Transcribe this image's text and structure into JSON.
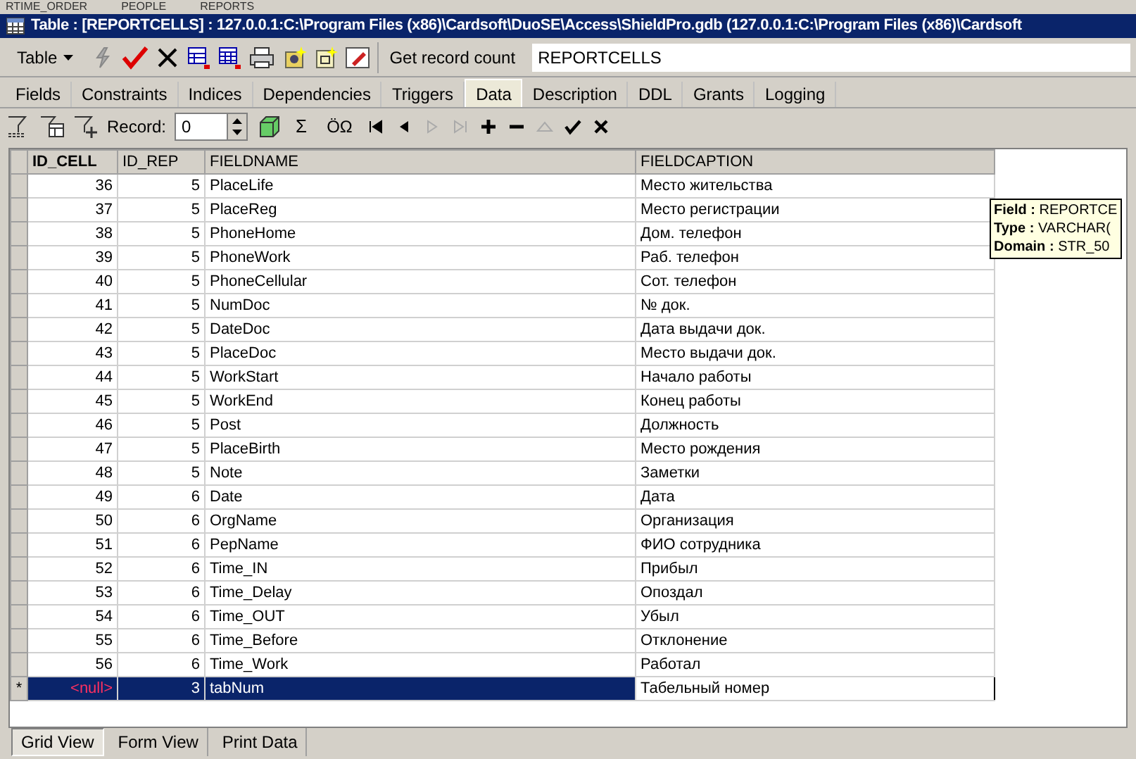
{
  "background_tabs": [
    "RTIME_ORDER",
    "PEOPLE",
    "REPORTS"
  ],
  "window": {
    "title": "Table : [REPORTCELLS] : 127.0.0.1:C:\\Program Files (x86)\\Cardsoft\\DuoSE\\Access\\ShieldPro.gdb (127.0.0.1:C:\\Program Files (x86)\\Cardsoft"
  },
  "toolbar": {
    "table_menu": "Table",
    "record_count_button": "Get record count",
    "table_name": "REPORTCELLS"
  },
  "tabs": [
    {
      "label": "Fields",
      "selected": false
    },
    {
      "label": "Constraints",
      "selected": false
    },
    {
      "label": "Indices",
      "selected": false
    },
    {
      "label": "Dependencies",
      "selected": false
    },
    {
      "label": "Triggers",
      "selected": false
    },
    {
      "label": "Data",
      "selected": true
    },
    {
      "label": "Description",
      "selected": false
    },
    {
      "label": "DDL",
      "selected": false
    },
    {
      "label": "Grants",
      "selected": false
    },
    {
      "label": "Logging",
      "selected": false
    }
  ],
  "data_toolbar": {
    "record_label": "Record:",
    "record_value": "0",
    "sum_symbol": "Σ",
    "special_chars": "ÖΩ"
  },
  "table": {
    "columns": [
      "ID_CELL",
      "ID_REP",
      "FIELDNAME",
      "FIELDCAPTION"
    ],
    "rows": [
      {
        "cells": [
          "36",
          "5",
          "PlaceLife",
          "Место жительства"
        ],
        "selected": false,
        "marker": ""
      },
      {
        "cells": [
          "37",
          "5",
          "PlaceReg",
          "Место регистрации"
        ],
        "selected": false,
        "marker": ""
      },
      {
        "cells": [
          "38",
          "5",
          "PhoneHome",
          "Дом. телефон"
        ],
        "selected": false,
        "marker": ""
      },
      {
        "cells": [
          "39",
          "5",
          "PhoneWork",
          "Раб. телефон"
        ],
        "selected": false,
        "marker": ""
      },
      {
        "cells": [
          "40",
          "5",
          "PhoneCellular",
          "Сот. телефон"
        ],
        "selected": false,
        "marker": ""
      },
      {
        "cells": [
          "41",
          "5",
          "NumDoc",
          "№ док."
        ],
        "selected": false,
        "marker": ""
      },
      {
        "cells": [
          "42",
          "5",
          "DateDoc",
          "Дата выдачи док."
        ],
        "selected": false,
        "marker": ""
      },
      {
        "cells": [
          "43",
          "5",
          "PlaceDoc",
          "Место выдачи док."
        ],
        "selected": false,
        "marker": ""
      },
      {
        "cells": [
          "44",
          "5",
          "WorkStart",
          "Начало работы"
        ],
        "selected": false,
        "marker": ""
      },
      {
        "cells": [
          "45",
          "5",
          "WorkEnd",
          "Конец работы"
        ],
        "selected": false,
        "marker": ""
      },
      {
        "cells": [
          "46",
          "5",
          "Post",
          "Должность"
        ],
        "selected": false,
        "marker": ""
      },
      {
        "cells": [
          "47",
          "5",
          "PlaceBirth",
          "Место рождения"
        ],
        "selected": false,
        "marker": ""
      },
      {
        "cells": [
          "48",
          "5",
          "Note",
          "Заметки"
        ],
        "selected": false,
        "marker": ""
      },
      {
        "cells": [
          "49",
          "6",
          "Date",
          "Дата"
        ],
        "selected": false,
        "marker": ""
      },
      {
        "cells": [
          "50",
          "6",
          "OrgName",
          "Организация"
        ],
        "selected": false,
        "marker": ""
      },
      {
        "cells": [
          "51",
          "6",
          "PepName",
          "ФИО сотрудника"
        ],
        "selected": false,
        "marker": ""
      },
      {
        "cells": [
          "52",
          "6",
          "Time_IN",
          "Прибыл"
        ],
        "selected": false,
        "marker": ""
      },
      {
        "cells": [
          "53",
          "6",
          "Time_Delay",
          "Опоздал"
        ],
        "selected": false,
        "marker": ""
      },
      {
        "cells": [
          "54",
          "6",
          "Time_OUT",
          "Убыл"
        ],
        "selected": false,
        "marker": ""
      },
      {
        "cells": [
          "55",
          "6",
          "Time_Before",
          "Отклонение"
        ],
        "selected": false,
        "marker": ""
      },
      {
        "cells": [
          "56",
          "6",
          "Time_Work",
          "Работал"
        ],
        "selected": false,
        "marker": ""
      },
      {
        "cells": [
          "<null>",
          "3",
          "tabNum",
          "Табельный номер"
        ],
        "selected": true,
        "marker": "*"
      }
    ]
  },
  "tooltip": {
    "lines": [
      {
        "label": "Field :",
        "value": "REPORTCE"
      },
      {
        "label": "Type :",
        "value": "VARCHAR("
      },
      {
        "label": "Domain :",
        "value": "STR_50"
      }
    ]
  },
  "view_tabs": [
    {
      "label": "Grid View",
      "selected": true
    },
    {
      "label": "Form View",
      "selected": false
    },
    {
      "label": "Print Data",
      "selected": false
    }
  ]
}
